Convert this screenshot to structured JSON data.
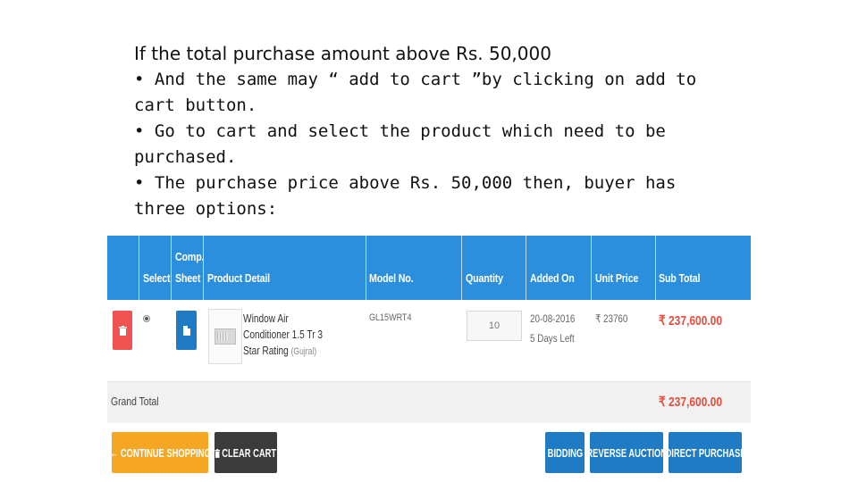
{
  "slide": {
    "lines": [
      "If the total purchase amount above Rs. 50,000",
      "• And the same may “ add to cart ”by clicking on add to",
      "cart button.",
      "• Go to cart and select the product which need to be",
      "purchased.",
      "• The purchase price above Rs. 50,000 then, buyer has",
      "three options:"
    ]
  },
  "cart": {
    "colors": {
      "header": "#2b8fde",
      "accent_red": "#e74c3c",
      "button_blue": "#1e7bc4",
      "button_orange": "#f5a623",
      "button_dark": "#3b3b3b"
    },
    "headers": {
      "select": "Select",
      "comp_sheet_line1": "Comp.",
      "comp_sheet_line2": "Sheet",
      "product_detail": "Product Detail",
      "model_no": "Model No.",
      "quantity": "Quantity",
      "added_on": "Added On",
      "unit_price": "Unit Price",
      "sub_total": "Sub Total"
    },
    "item": {
      "product_name": "Window Air Conditioner 1.5 Tr 3 Star Rating",
      "brand": "(Gujral)",
      "model": "GL15WRT4",
      "quantity": "10",
      "added_date": "20-08-2016",
      "added_ago": "5 Days Left",
      "unit_price": "₹ 23760",
      "sub_total": "₹ 237,600.00",
      "delete_icon": "trash-icon",
      "sheet_icon": "document-icon"
    },
    "grand_total": {
      "label": "Grand Total",
      "value": "₹ 237,600.00"
    }
  },
  "buttons": {
    "continue": "← CONTINUE SHOPPING",
    "clear": "CLEAR CART",
    "clear_icon": "trash-icon",
    "bidding": "BIDDING",
    "reverse_auction": "REVERSE AUCTION",
    "direct_purchase": "DIRECT PURCHASE"
  }
}
